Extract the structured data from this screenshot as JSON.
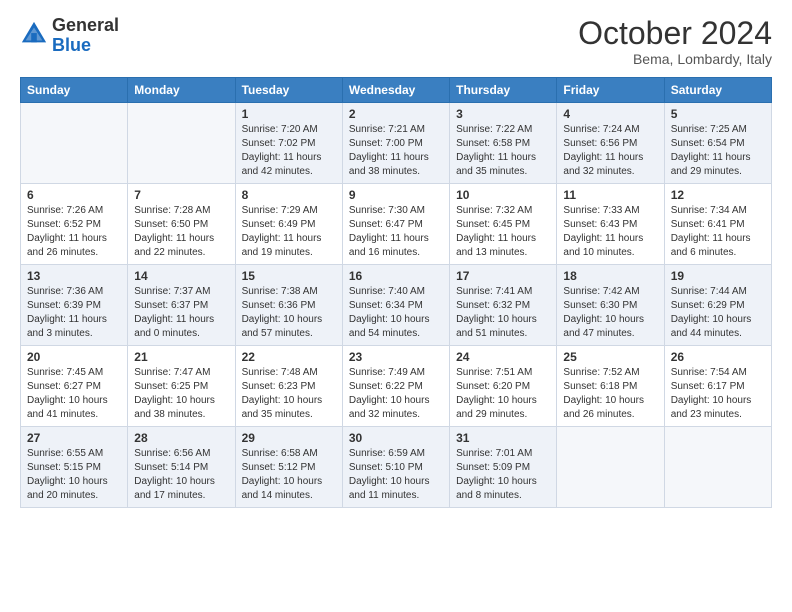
{
  "header": {
    "logo_general": "General",
    "logo_blue": "Blue",
    "title": "October 2024",
    "location": "Bema, Lombardy, Italy"
  },
  "days_of_week": [
    "Sunday",
    "Monday",
    "Tuesday",
    "Wednesday",
    "Thursday",
    "Friday",
    "Saturday"
  ],
  "weeks": [
    [
      {
        "day": "",
        "info": ""
      },
      {
        "day": "",
        "info": ""
      },
      {
        "day": "1",
        "info": "Sunrise: 7:20 AM\nSunset: 7:02 PM\nDaylight: 11 hours\nand 42 minutes."
      },
      {
        "day": "2",
        "info": "Sunrise: 7:21 AM\nSunset: 7:00 PM\nDaylight: 11 hours\nand 38 minutes."
      },
      {
        "day": "3",
        "info": "Sunrise: 7:22 AM\nSunset: 6:58 PM\nDaylight: 11 hours\nand 35 minutes."
      },
      {
        "day": "4",
        "info": "Sunrise: 7:24 AM\nSunset: 6:56 PM\nDaylight: 11 hours\nand 32 minutes."
      },
      {
        "day": "5",
        "info": "Sunrise: 7:25 AM\nSunset: 6:54 PM\nDaylight: 11 hours\nand 29 minutes."
      }
    ],
    [
      {
        "day": "6",
        "info": "Sunrise: 7:26 AM\nSunset: 6:52 PM\nDaylight: 11 hours\nand 26 minutes."
      },
      {
        "day": "7",
        "info": "Sunrise: 7:28 AM\nSunset: 6:50 PM\nDaylight: 11 hours\nand 22 minutes."
      },
      {
        "day": "8",
        "info": "Sunrise: 7:29 AM\nSunset: 6:49 PM\nDaylight: 11 hours\nand 19 minutes."
      },
      {
        "day": "9",
        "info": "Sunrise: 7:30 AM\nSunset: 6:47 PM\nDaylight: 11 hours\nand 16 minutes."
      },
      {
        "day": "10",
        "info": "Sunrise: 7:32 AM\nSunset: 6:45 PM\nDaylight: 11 hours\nand 13 minutes."
      },
      {
        "day": "11",
        "info": "Sunrise: 7:33 AM\nSunset: 6:43 PM\nDaylight: 11 hours\nand 10 minutes."
      },
      {
        "day": "12",
        "info": "Sunrise: 7:34 AM\nSunset: 6:41 PM\nDaylight: 11 hours\nand 6 minutes."
      }
    ],
    [
      {
        "day": "13",
        "info": "Sunrise: 7:36 AM\nSunset: 6:39 PM\nDaylight: 11 hours\nand 3 minutes."
      },
      {
        "day": "14",
        "info": "Sunrise: 7:37 AM\nSunset: 6:37 PM\nDaylight: 11 hours\nand 0 minutes."
      },
      {
        "day": "15",
        "info": "Sunrise: 7:38 AM\nSunset: 6:36 PM\nDaylight: 10 hours\nand 57 minutes."
      },
      {
        "day": "16",
        "info": "Sunrise: 7:40 AM\nSunset: 6:34 PM\nDaylight: 10 hours\nand 54 minutes."
      },
      {
        "day": "17",
        "info": "Sunrise: 7:41 AM\nSunset: 6:32 PM\nDaylight: 10 hours\nand 51 minutes."
      },
      {
        "day": "18",
        "info": "Sunrise: 7:42 AM\nSunset: 6:30 PM\nDaylight: 10 hours\nand 47 minutes."
      },
      {
        "day": "19",
        "info": "Sunrise: 7:44 AM\nSunset: 6:29 PM\nDaylight: 10 hours\nand 44 minutes."
      }
    ],
    [
      {
        "day": "20",
        "info": "Sunrise: 7:45 AM\nSunset: 6:27 PM\nDaylight: 10 hours\nand 41 minutes."
      },
      {
        "day": "21",
        "info": "Sunrise: 7:47 AM\nSunset: 6:25 PM\nDaylight: 10 hours\nand 38 minutes."
      },
      {
        "day": "22",
        "info": "Sunrise: 7:48 AM\nSunset: 6:23 PM\nDaylight: 10 hours\nand 35 minutes."
      },
      {
        "day": "23",
        "info": "Sunrise: 7:49 AM\nSunset: 6:22 PM\nDaylight: 10 hours\nand 32 minutes."
      },
      {
        "day": "24",
        "info": "Sunrise: 7:51 AM\nSunset: 6:20 PM\nDaylight: 10 hours\nand 29 minutes."
      },
      {
        "day": "25",
        "info": "Sunrise: 7:52 AM\nSunset: 6:18 PM\nDaylight: 10 hours\nand 26 minutes."
      },
      {
        "day": "26",
        "info": "Sunrise: 7:54 AM\nSunset: 6:17 PM\nDaylight: 10 hours\nand 23 minutes."
      }
    ],
    [
      {
        "day": "27",
        "info": "Sunrise: 6:55 AM\nSunset: 5:15 PM\nDaylight: 10 hours\nand 20 minutes."
      },
      {
        "day": "28",
        "info": "Sunrise: 6:56 AM\nSunset: 5:14 PM\nDaylight: 10 hours\nand 17 minutes."
      },
      {
        "day": "29",
        "info": "Sunrise: 6:58 AM\nSunset: 5:12 PM\nDaylight: 10 hours\nand 14 minutes."
      },
      {
        "day": "30",
        "info": "Sunrise: 6:59 AM\nSunset: 5:10 PM\nDaylight: 10 hours\nand 11 minutes."
      },
      {
        "day": "31",
        "info": "Sunrise: 7:01 AM\nSunset: 5:09 PM\nDaylight: 10 hours\nand 8 minutes."
      },
      {
        "day": "",
        "info": ""
      },
      {
        "day": "",
        "info": ""
      }
    ]
  ]
}
